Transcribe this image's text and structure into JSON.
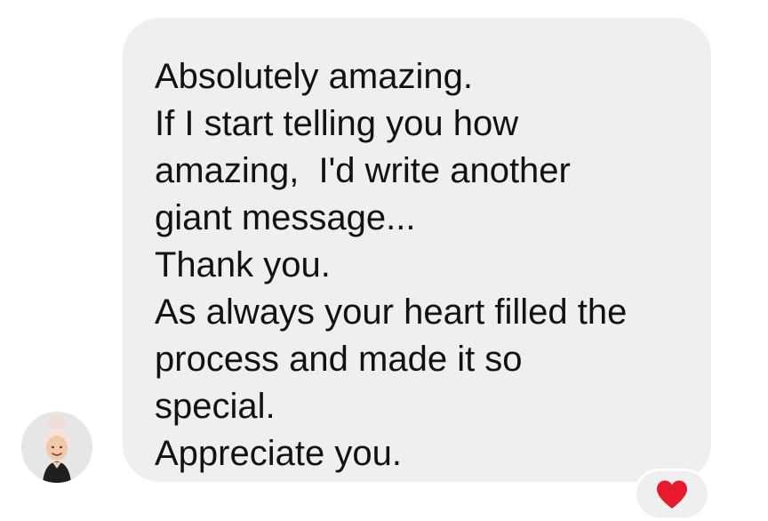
{
  "message": {
    "lines": [
      "Absolutely amazing.",
      "If I start telling you how",
      "amazing,  I'd write another",
      "giant message...",
      "Thank you.",
      "As always your heart filled the",
      "process and made it so",
      "special.",
      "Appreciate you."
    ]
  },
  "reaction": {
    "icon": "heart-icon",
    "color": "#e8192c"
  },
  "avatar": {
    "icon": "avatar"
  },
  "colors": {
    "bubble": "#efefef",
    "text": "#121212",
    "background": "#ffffff"
  }
}
